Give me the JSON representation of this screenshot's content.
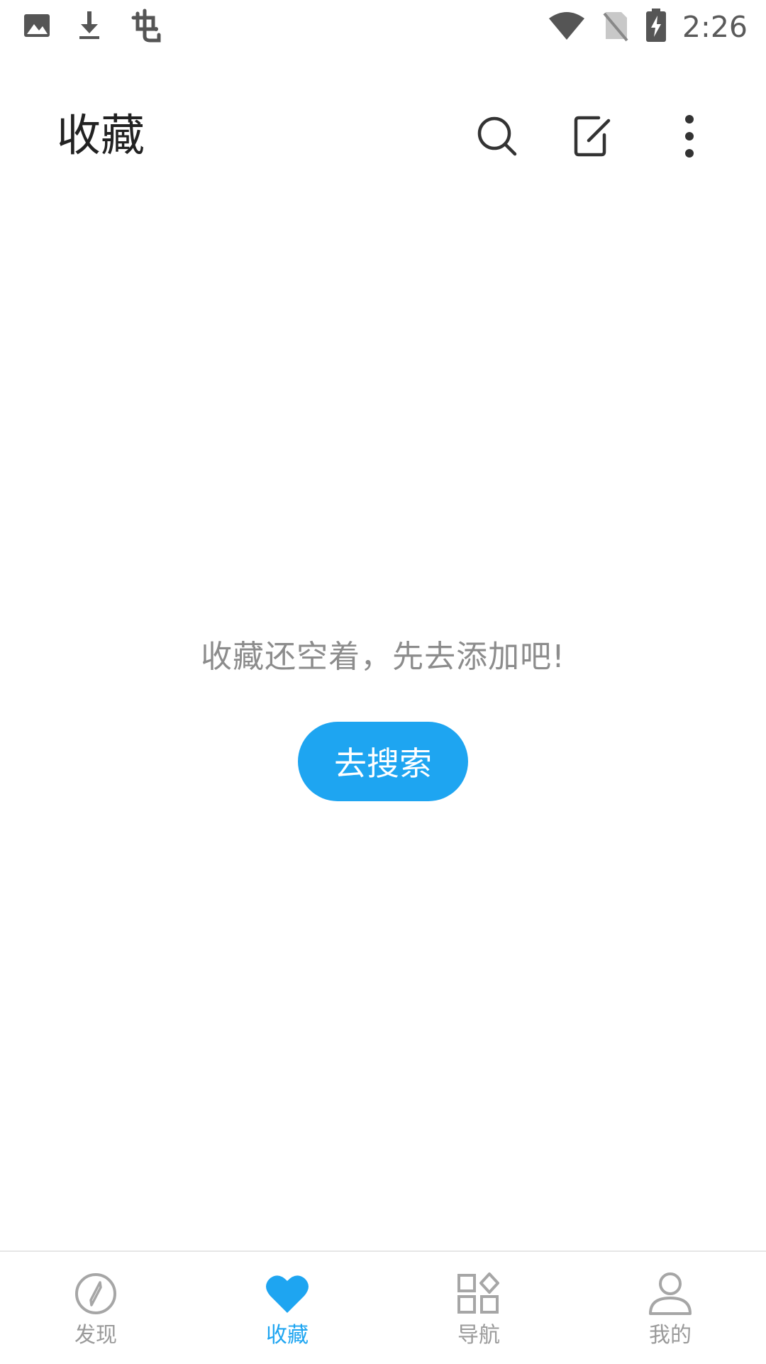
{
  "status_bar": {
    "left_icons": [
      "image-icon",
      "download-icon",
      "app-bug-icon"
    ],
    "right_icons": [
      "wifi-icon",
      "no-sim-icon",
      "battery-charging-icon"
    ],
    "time": "2:26"
  },
  "app_bar": {
    "title": "收藏",
    "actions": [
      "search-icon",
      "edit-icon",
      "more-vert-icon"
    ]
  },
  "empty_state": {
    "message": "收藏还空着，先去添加吧!",
    "button_label": "去搜索"
  },
  "bottom_nav": {
    "items": [
      {
        "label": "发现",
        "icon": "compass-icon",
        "active": false
      },
      {
        "label": "收藏",
        "icon": "heart-icon",
        "active": true
      },
      {
        "label": "导航",
        "icon": "grid-icon",
        "active": false
      },
      {
        "label": "我的",
        "icon": "user-icon",
        "active": false
      }
    ]
  },
  "colors": {
    "accent": "#1ea5f1",
    "inactive": "#9a9a9a",
    "title": "#222222",
    "empty_text": "#8c8c8c"
  }
}
